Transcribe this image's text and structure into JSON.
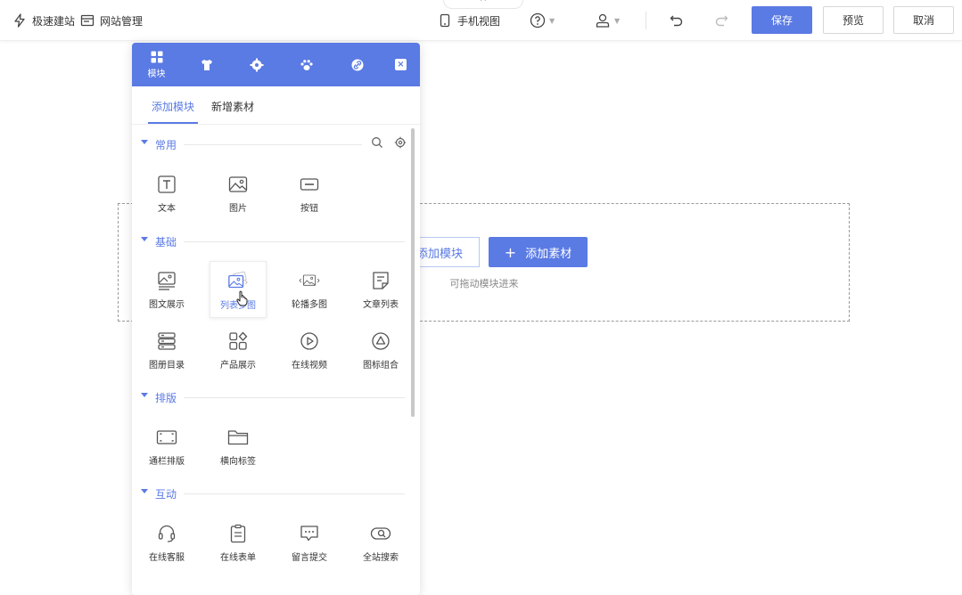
{
  "topbar": {
    "quick_build": "极速建站",
    "site_manage": "网站管理",
    "mobile_view": "手机视图",
    "save": "保存",
    "preview": "预览",
    "cancel": "取消",
    "collapse_glyph": "^"
  },
  "panel": {
    "header_active_label": "模块",
    "close_glyph": "×",
    "tabs": [
      "添加模块",
      "新增素材"
    ],
    "sections": [
      {
        "title": "常用",
        "items": [
          "文本",
          "图片",
          "按钮"
        ]
      },
      {
        "title": "基础",
        "items": [
          "图文展示",
          "列表多图",
          "轮播多图",
          "文章列表",
          "图册目录",
          "产品展示",
          "在线视频",
          "图标组合"
        ]
      },
      {
        "title": "排版",
        "items": [
          "通栏排版",
          "横向标签"
        ]
      },
      {
        "title": "互动",
        "items": [
          "在线客服",
          "在线表单",
          "留言提交",
          "全站搜索"
        ]
      }
    ]
  },
  "dropzone": {
    "add_module": "添加模块",
    "add_material_plus": "+",
    "add_material": "添加素材",
    "hint": "可拖动模块进来"
  },
  "colors": {
    "accent": "#5a7ae4"
  }
}
